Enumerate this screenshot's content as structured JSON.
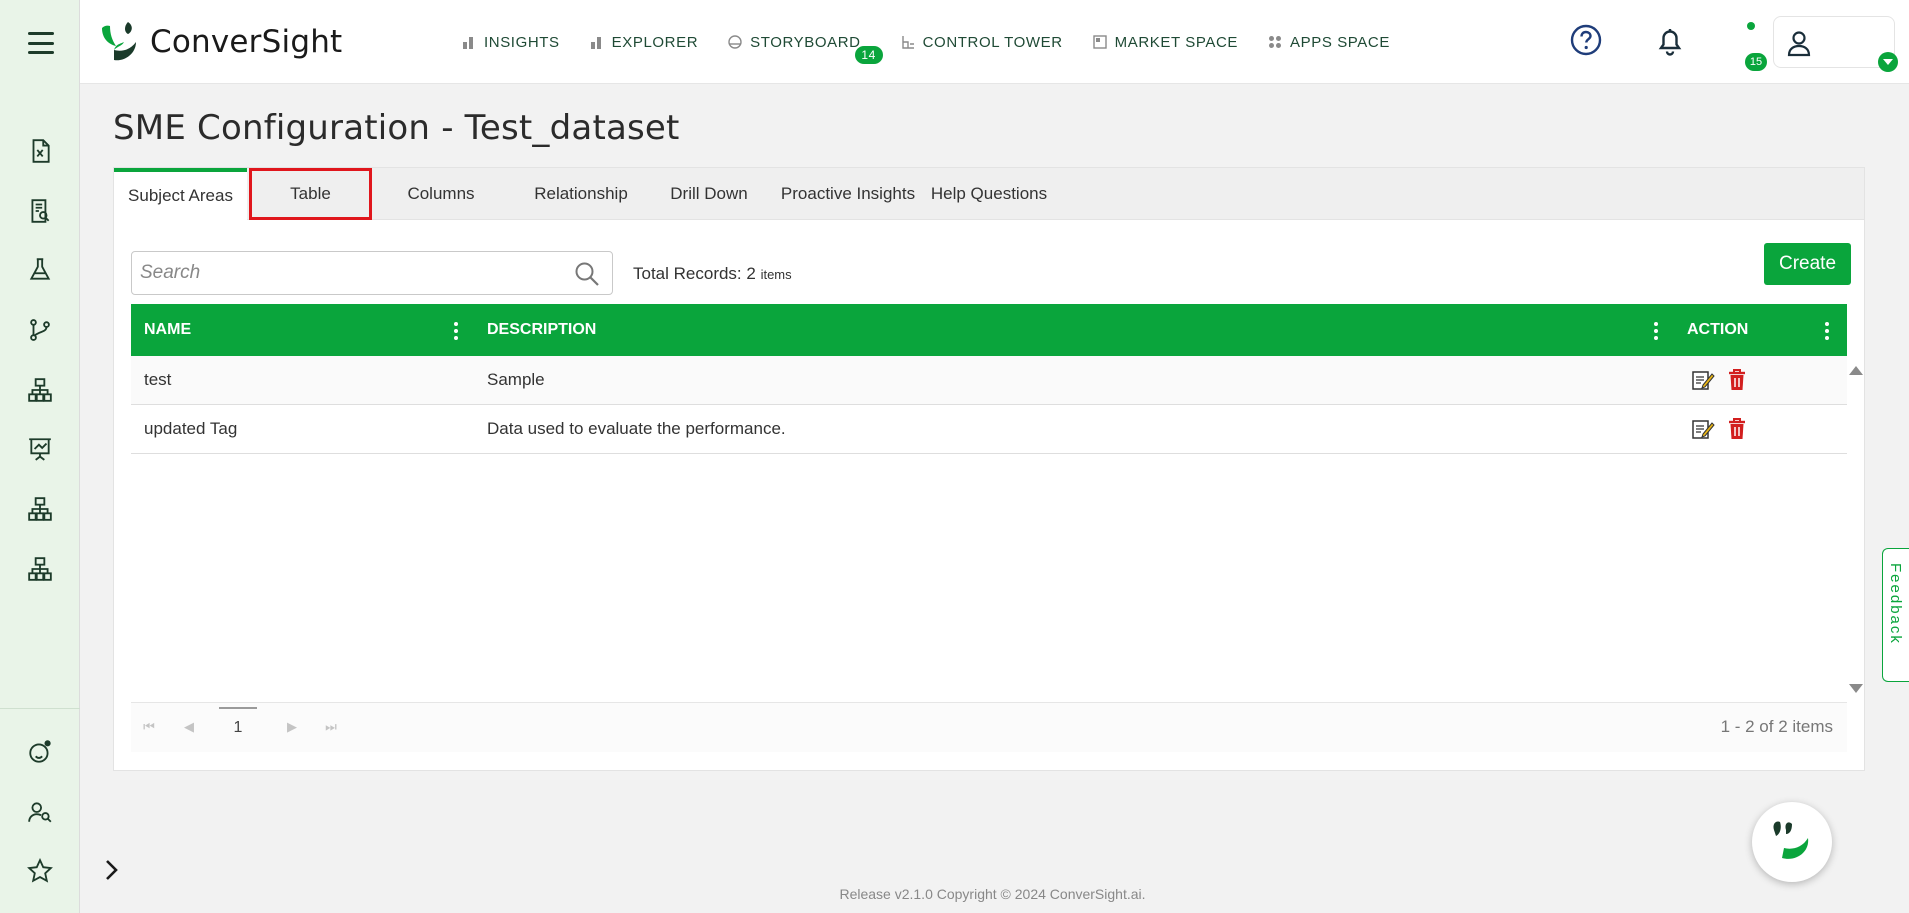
{
  "app": {
    "brand_name": "ConverSight",
    "accent_color": "#0aa53c"
  },
  "sidebar": {
    "menu_icon": "hamburger-menu-icon",
    "items": [
      {
        "name": "excel-file-icon"
      },
      {
        "name": "report-search-icon"
      },
      {
        "name": "flask-icon"
      },
      {
        "name": "git-branch-icon"
      },
      {
        "name": "hierarchy-icon"
      },
      {
        "name": "presentation-chart-icon"
      },
      {
        "name": "hierarchy-icon-2"
      },
      {
        "name": "hierarchy-icon-3"
      }
    ],
    "bottom_items": [
      {
        "name": "assistant-face-icon"
      },
      {
        "name": "user-search-icon"
      },
      {
        "name": "star-icon"
      }
    ]
  },
  "nav": {
    "items": [
      {
        "label": "INSIGHTS",
        "icon": "bar-chart-icon"
      },
      {
        "label": "EXPLORER",
        "icon": "bar-chart-icon"
      },
      {
        "label": "STORYBOARD",
        "icon": "storyboard-icon",
        "badge": "14"
      },
      {
        "label": "CONTROL TOWER",
        "icon": "control-tower-icon"
      },
      {
        "label": "MARKET SPACE",
        "icon": "market-space-icon"
      },
      {
        "label": "APPS SPACE",
        "icon": "apps-grid-icon"
      }
    ],
    "notifications_badge": "15"
  },
  "page": {
    "title": "SME Configuration - Test_dataset"
  },
  "tabs": [
    "Subject Areas",
    "Table",
    "Columns",
    "Relationship",
    "Drill Down",
    "Proactive Insights",
    "Help Questions"
  ],
  "toolbar": {
    "search_placeholder": "Search",
    "total_label": "Total Records: 2",
    "total_unit": "items",
    "create_label": "Create"
  },
  "grid": {
    "columns": [
      "NAME",
      "DESCRIPTION",
      "ACTION"
    ],
    "rows": [
      {
        "name": "test",
        "description": "Sample"
      },
      {
        "name": "updated Tag",
        "description": "Data used to evaluate the performance."
      }
    ]
  },
  "pager": {
    "current_page": "1",
    "info": "1 - 2 of 2 items"
  },
  "feedback_label": "Feedback",
  "footer": "Release v2.1.0 Copyright © 2024 ConverSight.ai."
}
